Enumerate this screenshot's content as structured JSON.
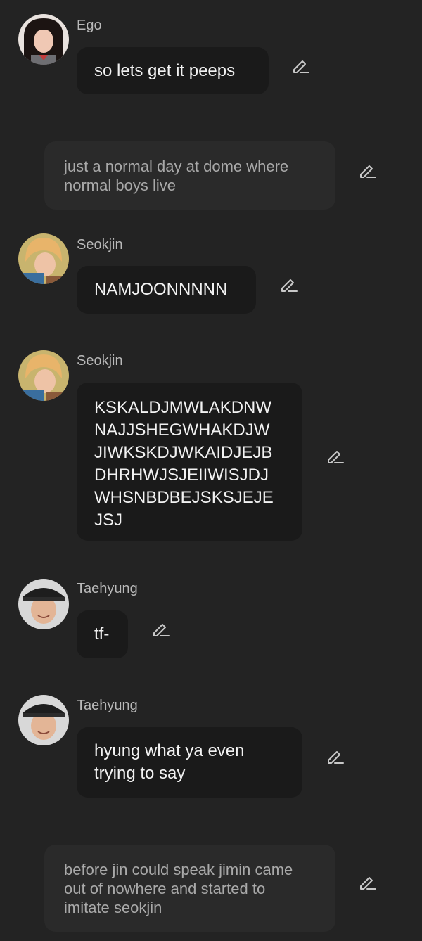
{
  "messages": [
    {
      "kind": "chat",
      "sender": "Ego",
      "text": "so lets get it peeps"
    },
    {
      "kind": "narration",
      "text": "just a normal day at dome where\nnormal boys live"
    },
    {
      "kind": "chat",
      "sender": "Seokjin",
      "text": "NAMJOONNNNN"
    },
    {
      "kind": "chat",
      "sender": "Seokjin",
      "text": "KSKALDJMWLAKDNW\nNAJJSHEGWHAKDJW\nJIWKSKDJWKAIDJEJB\nDHRHWJSJEIIWISJDJ\nWHSNBDBEJSKSJEJE\nJSJ"
    },
    {
      "kind": "chat",
      "sender": "Taehyung",
      "text": "tf-"
    },
    {
      "kind": "chat",
      "sender": "Taehyung",
      "text": "hyung what ya even\ntrying to say"
    },
    {
      "kind": "narration",
      "text": "before jin could speak jimin came\nout of nowhere and started to\nimitate seokjin"
    }
  ],
  "colors": {
    "background": "#232323",
    "chat_bubble": "#1a1a1a",
    "narration_bubble": "#2a2a2a",
    "sender_name": "#b9b9b9",
    "edit_icon": "#c8c8c8"
  },
  "icons": {
    "avatar": "avatar-image",
    "edit": "pencil-edit-icon"
  }
}
